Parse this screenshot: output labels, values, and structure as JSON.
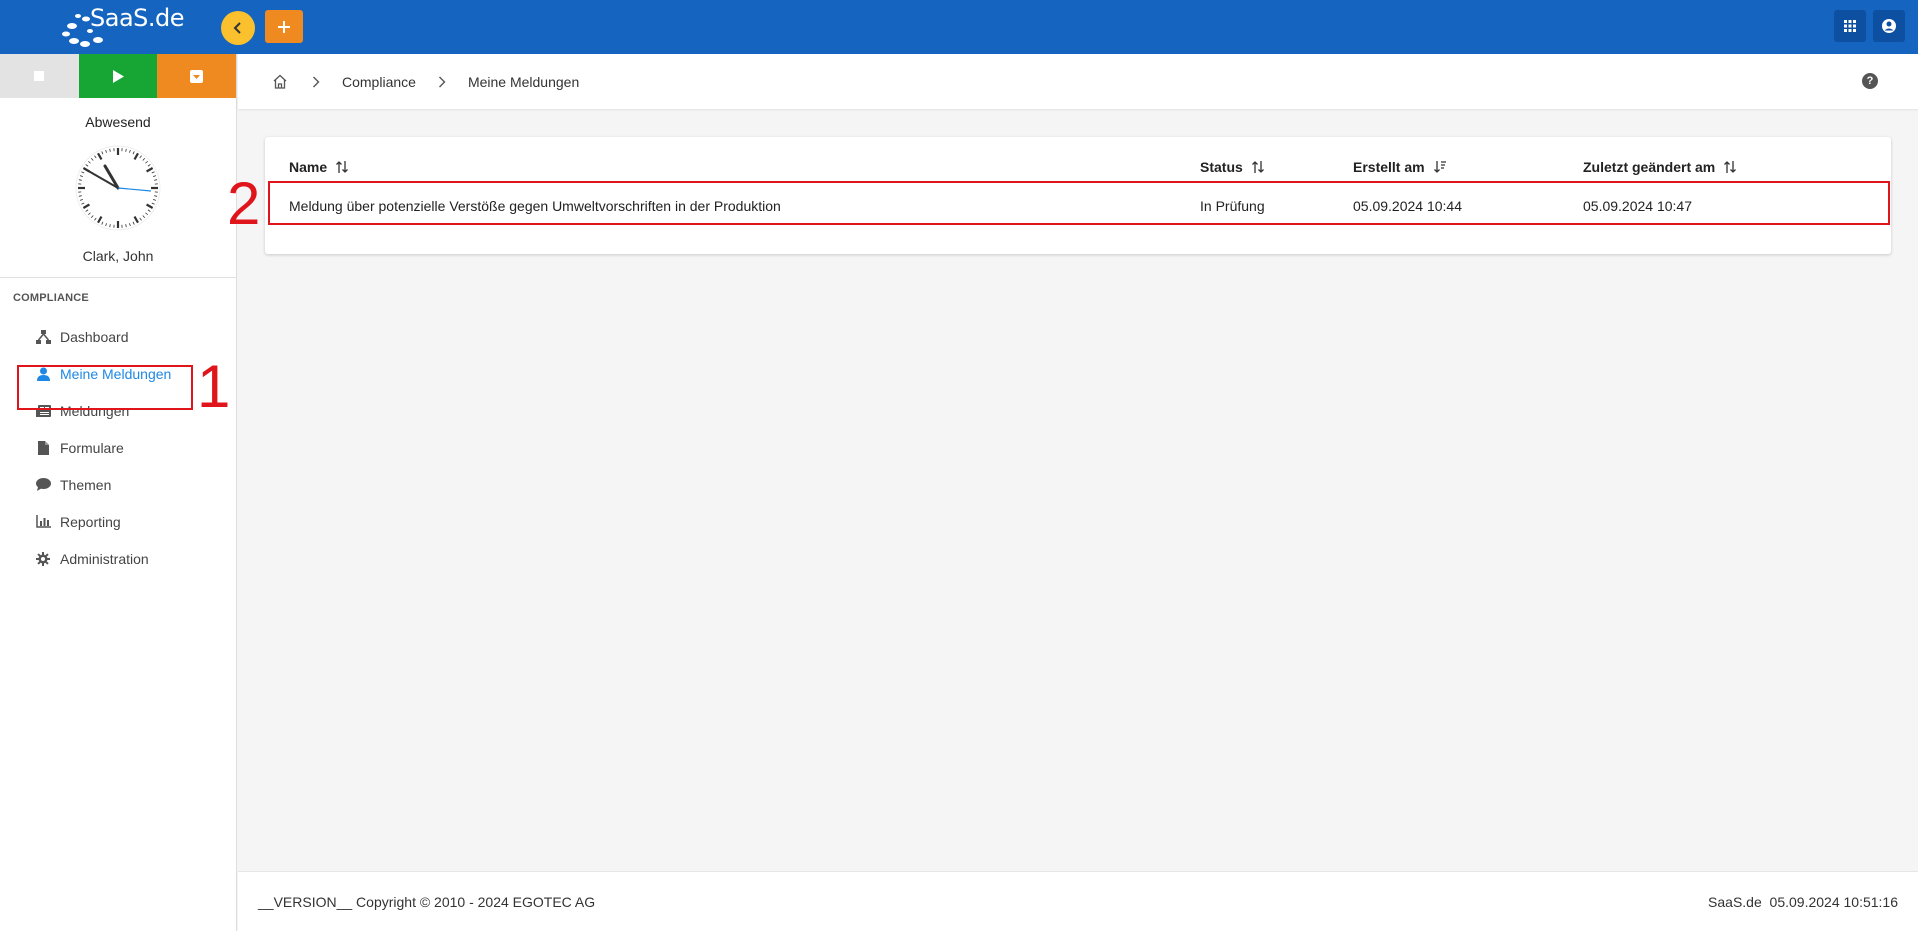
{
  "header": {
    "logo_text": "SaaS.de",
    "colors": {
      "bar": "#1565c0",
      "back_button": "#fbc02d",
      "add_button": "#ef8a20"
    }
  },
  "sidebar": {
    "presence_status": "Abwesend",
    "user_name": "Clark, John",
    "section_title": "COMPLIANCE",
    "items": [
      {
        "label": "Dashboard",
        "icon": "sitemap-icon"
      },
      {
        "label": "Meine Meldungen",
        "icon": "user-icon",
        "active": true
      },
      {
        "label": "Meldungen",
        "icon": "newspaper-icon"
      },
      {
        "label": "Formulare",
        "icon": "file-icon"
      },
      {
        "label": "Themen",
        "icon": "comment-icon"
      },
      {
        "label": "Reporting",
        "icon": "bar-chart-icon"
      },
      {
        "label": "Administration",
        "icon": "gear-icon"
      }
    ],
    "accent_color": "#1e88e5"
  },
  "breadcrumb": {
    "items": [
      "Compliance",
      "Meine Meldungen"
    ]
  },
  "table": {
    "columns": [
      "Name",
      "Status",
      "Erstellt am",
      "Zuletzt geändert am"
    ],
    "rows": [
      {
        "name": "Meldung über potenzielle Verstöße gegen Umweltvorschriften in der Produktion",
        "status": "In Prüfung",
        "created": "05.09.2024 10:44",
        "modified": "05.09.2024 10:47"
      }
    ]
  },
  "annotations": {
    "label_1": "1",
    "label_2": "2",
    "color": "#e0151b"
  },
  "footer": {
    "left": "__VERSION__ Copyright © 2010 - 2024 EGOTEC AG",
    "right": "SaaS.de  05.09.2024 10:51:16"
  }
}
